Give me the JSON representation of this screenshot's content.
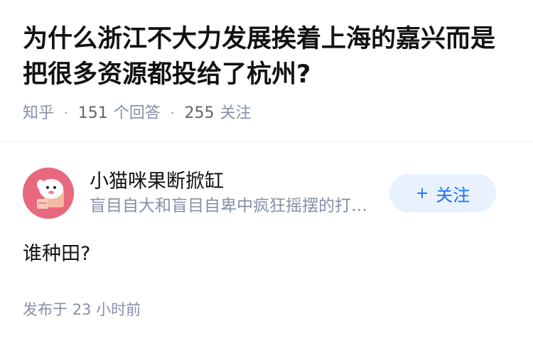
{
  "question": {
    "title": "为什么浙江不大力发展挨着上海的嘉兴而是把很多资源都投给了杭州?",
    "source": "知乎",
    "answers_count": "151",
    "answers_label": "个回答",
    "followers_count": "255",
    "followers_label": "关注"
  },
  "answer": {
    "author": {
      "name": "小猫咪果断掀缸",
      "headline": "盲目自大和盲目自卑中疯狂摇摆的打工人",
      "avatar_icon": "cartoon-avatar-icon",
      "avatar_color": "#e8697f"
    },
    "follow_button": {
      "plus": "+",
      "label": "关注",
      "color": "#1772f6",
      "background": "#e9f1fc"
    },
    "content": "谁种田?",
    "publish_prefix": "发布于",
    "publish_time": "23 小时前"
  }
}
